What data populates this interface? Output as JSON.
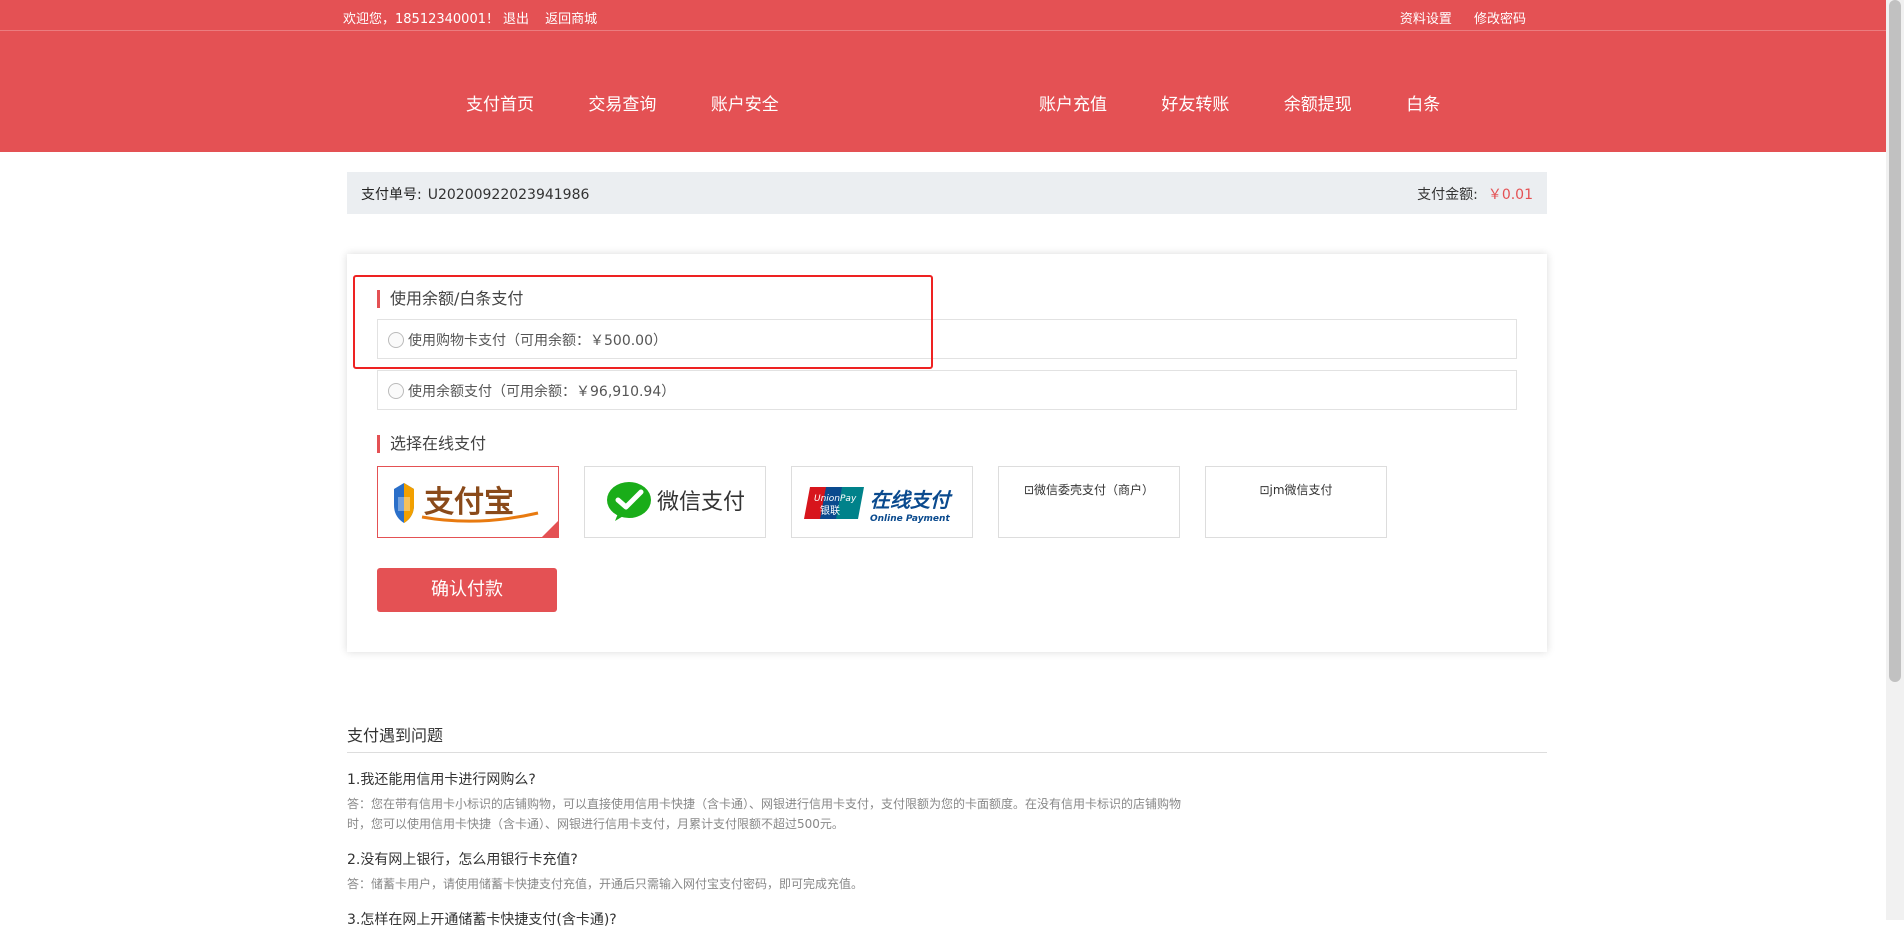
{
  "topbar": {
    "welcome": "欢迎您，18512340001！",
    "logout": "退出",
    "back_to_mall": "返回商城",
    "profile_settings": "资料设置",
    "change_password": "修改密码"
  },
  "nav_left": [
    "支付首页",
    "交易查询",
    "账户安全"
  ],
  "nav_right": [
    "账户充值",
    "好友转账",
    "余额提现",
    "白条"
  ],
  "order": {
    "number_label": "支付单号:",
    "number": "U20200922023941986",
    "amount_label": "支付金额:",
    "amount": "￥0.01"
  },
  "balance_section": {
    "title": "使用余额/白条支付",
    "options": [
      "使用购物卡支付（可用余额：￥500.00）",
      "使用余额支付（可用余额：￥96,910.94）"
    ]
  },
  "online_section": {
    "title": "选择在线支付",
    "methods": [
      {
        "name": "支付宝",
        "icon": "alipay-logo",
        "selected": true
      },
      {
        "name": "微信支付",
        "icon": "wechat-pay-logo",
        "selected": false
      },
      {
        "name": "在线支付",
        "sub": "Online Payment",
        "brand": "UnionPay",
        "brand_cn": "银联",
        "icon": "unionpay-logo",
        "selected": false
      },
      {
        "name": "微信委壳支付（商户）",
        "icon": "broken-image",
        "selected": false
      },
      {
        "name": "jm微信支付",
        "icon": "broken-image",
        "selected": false
      }
    ]
  },
  "confirm_button": "确认付款",
  "faq": {
    "title": "支付遇到问题",
    "items": [
      {
        "q": "1.我还能用信用卡进行网购么?",
        "a": "答：您在带有信用卡小标识的店铺购物，可以直接使用信用卡快捷（含卡通）、网银进行信用卡支付，支付限额为您的卡面额度。在没有信用卡标识的店铺购物时，您可以使用信用卡快捷（含卡通）、网银进行信用卡支付，月累计支付限额不超过500元。"
      },
      {
        "q": "2.没有网上银行，怎么用银行卡充值?",
        "a": "答：储蓄卡用户，请使用储蓄卡快捷支付充值，开通后只需输入网付宝支付密码，即可完成充值。"
      },
      {
        "q": "3.怎样在网上开通储蓄卡快捷支付(含卡通)?",
        "a": ""
      }
    ]
  },
  "colors": {
    "brand_red": "#e45154",
    "highlight_border": "#ee2222",
    "order_bar_bg": "#ebeef1"
  }
}
